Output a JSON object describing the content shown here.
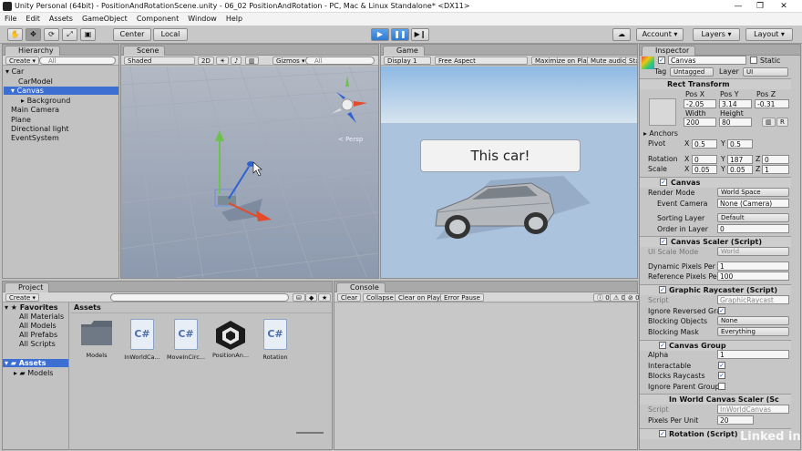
{
  "window": {
    "title": "Unity Personal (64bit) - PositionAndRotationScene.unity - 06_02 PositionAndRotation - PC, Mac & Linux Standalone* <DX11>"
  },
  "menu": [
    "File",
    "Edit",
    "Assets",
    "GameObject",
    "Component",
    "Window",
    "Help"
  ],
  "toolbar": {
    "pivot_mode": "Center",
    "space_mode": "Local",
    "account": "Account",
    "layers": "Layers",
    "layout": "Layout"
  },
  "hierarchy": {
    "tab": "Hierarchy",
    "create": "Create",
    "search_placeholder": "All",
    "items": [
      "Car",
      "CarModel",
      "Canvas",
      "Background",
      "Main Camera",
      "Plane",
      "Directional light",
      "EventSystem"
    ]
  },
  "scene": {
    "tab": "Scene",
    "shading": "Shaded",
    "mode2d": "2D",
    "gizmos": "Gizmos",
    "search_placeholder": "All",
    "persp": "< Persp"
  },
  "game": {
    "tab": "Game",
    "display": "Display 1",
    "aspect": "Free Aspect",
    "maximize": "Maximize on Play",
    "mute": "Mute audio",
    "stats": "Stats",
    "ui_text": "This car!"
  },
  "project": {
    "tab": "Project",
    "create": "Create",
    "favorites_header": "Favorites",
    "favorites": [
      "All Materials",
      "All Models",
      "All Prefabs",
      "All Scripts"
    ],
    "assets_header": "Assets",
    "assets_sub": [
      "Models"
    ],
    "breadcrumb": "Assets",
    "assets": [
      {
        "name": "Models",
        "kind": "folder"
      },
      {
        "name": "InWorldCa...",
        "kind": "script"
      },
      {
        "name": "MoveInCirc...",
        "kind": "script"
      },
      {
        "name": "PositionAn...",
        "kind": "unity"
      },
      {
        "name": "Rotation",
        "kind": "script"
      }
    ]
  },
  "console": {
    "tab": "Console",
    "buttons": [
      "Clear",
      "Collapse",
      "Clear on Play",
      "Error Pause"
    ],
    "counts": [
      "0",
      "0",
      "0"
    ]
  },
  "inspector": {
    "tab": "Inspector",
    "object_name": "Canvas",
    "static": "Static",
    "tag_label": "Tag",
    "tag": "Untagged",
    "layer_label": "Layer",
    "layer": "UI",
    "rect_transform": {
      "title": "Rect Transform",
      "headers": [
        "Pos X",
        "Pos Y",
        "Pos Z"
      ],
      "pos": [
        "-2.05",
        "3.14",
        "-0.31"
      ],
      "wh_headers": [
        "Width",
        "Height"
      ],
      "wh": [
        "200",
        "80"
      ],
      "anchors": "Anchors",
      "pivot_label": "Pivot",
      "pivot": [
        "0.5",
        "0.5"
      ],
      "rotation_label": "Rotation",
      "rotation": [
        "0",
        "187",
        "0"
      ],
      "scale_label": "Scale",
      "scale": [
        "0.05",
        "0.05",
        "1"
      ]
    },
    "canvas": {
      "title": "Canvas",
      "render_mode_label": "Render Mode",
      "render_mode": "World Space",
      "camera_label": "Event Camera",
      "camera": "None (Camera)",
      "sorting_label": "Sorting Layer",
      "sorting": "Default",
      "order_label": "Order in Layer",
      "order": "0"
    },
    "scaler": {
      "title": "Canvas Scaler (Script)",
      "ui_scale_label": "UI Scale Mode",
      "ui_scale": "World",
      "dpu_label": "Dynamic Pixels Per U",
      "dpu": "1",
      "rppu_label": "Reference Pixels Per",
      "rppu": "100"
    },
    "raycaster": {
      "title": "Graphic Raycaster (Script)",
      "script_label": "Script",
      "script": "GraphicRaycast",
      "ignore_label": "Ignore Reversed Gra",
      "blocking_label": "Blocking Objects",
      "blocking": "None",
      "mask_label": "Blocking Mask",
      "mask": "Everything"
    },
    "group": {
      "title": "Canvas Group",
      "alpha_label": "Alpha",
      "alpha": "1",
      "interactable_label": "Interactable",
      "blocks_label": "Blocks Raycasts",
      "ignore_parent_label": "Ignore Parent Groups"
    },
    "inworld": {
      "title": "In World Canvas Scaler (Sc",
      "script_label": "Script",
      "script": "InWorldCanvas",
      "ppu_label": "Pixels Per Unit",
      "ppu": "20"
    },
    "rotation": {
      "title": "Rotation (Script)"
    }
  },
  "watermark": "Linked in"
}
